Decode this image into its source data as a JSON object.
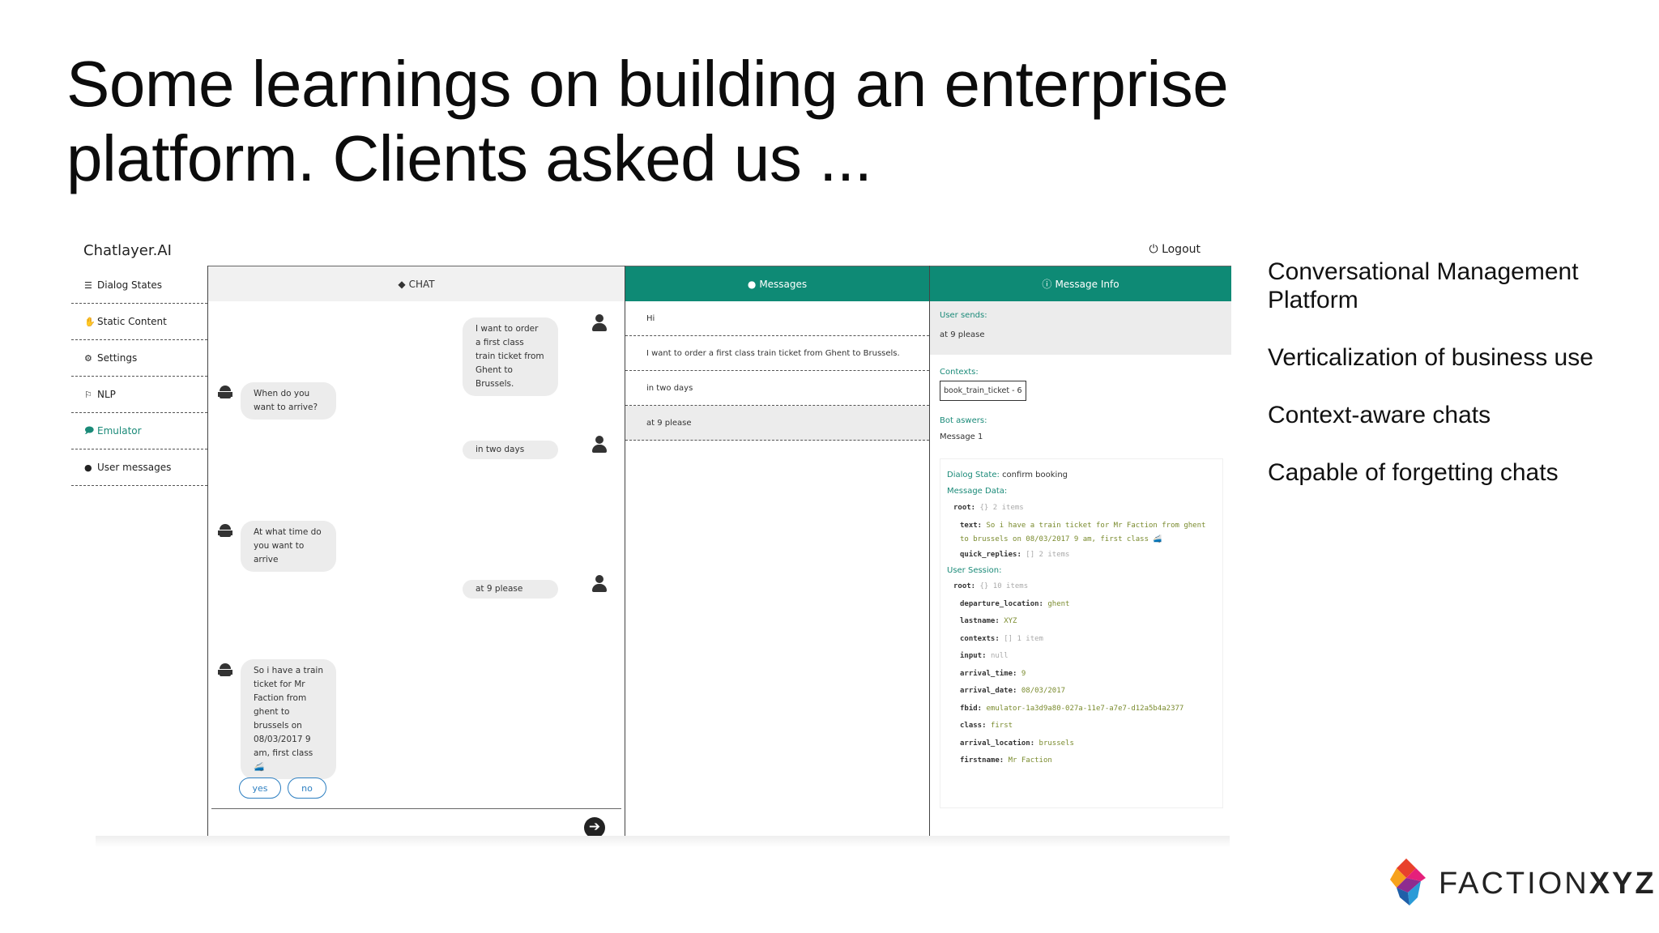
{
  "slide": {
    "title_line1": "Some learnings on building an enterprise",
    "title_line2": "platform. Clients asked us ...",
    "bullets": [
      "Conversational Management Platform",
      "Verticalization of business use",
      "Context-aware chats",
      "Capable of forgetting chats"
    ],
    "logo": {
      "light": "FACTION",
      "bold": "XYZ"
    }
  },
  "app": {
    "brand": "Chatlayer.AI",
    "logout": "Logout",
    "sidebar": [
      {
        "label": "Dialog States",
        "icon": "sitemap-icon"
      },
      {
        "label": "Static Content",
        "icon": "hand-icon"
      },
      {
        "label": "Settings",
        "icon": "gears-icon"
      },
      {
        "label": "NLP",
        "icon": "language-icon"
      },
      {
        "label": "Emulator",
        "icon": "comment-icon",
        "active": true
      },
      {
        "label": "User messages",
        "icon": "comments-icon"
      }
    ],
    "chat": {
      "header": "CHAT",
      "messages": [
        {
          "from": "user",
          "text": "I want to order a first class train ticket from Ghent to Brussels."
        },
        {
          "from": "bot",
          "text": "When do you want to arrive?"
        },
        {
          "from": "user",
          "text": "in two days"
        },
        {
          "from": "bot",
          "text": "At what time do you want to arrive"
        },
        {
          "from": "user",
          "text": "at 9 please"
        },
        {
          "from": "bot",
          "text": "So i have a train ticket for Mr Faction from ghent to brussels on 08/03/2017 9 am, first class 🚄"
        }
      ],
      "quick_replies": [
        "yes",
        "no"
      ]
    },
    "messages": {
      "header": "Messages",
      "items": [
        "Hi",
        "I want to order a first class train ticket from Ghent to Brussels.",
        "in two days",
        "at 9 please"
      ]
    },
    "info": {
      "header": "Message Info",
      "user_sends_label": "User sends:",
      "user_sends": "at 9 please",
      "contexts_label": "Contexts:",
      "context_tag": "book_train_ticket - 6",
      "bot_answers_label": "Bot aswers:",
      "bot_answer": "Message 1",
      "dialog_state_label": "Dialog State:",
      "dialog_state": "confirm booking",
      "message_data_label": "Message Data:",
      "md_root": "{} 2 items",
      "md_text": "So i have a train ticket for Mr Faction from ghent to brussels on 08/03/2017 9 am, first class 🚄",
      "md_quick": "[] 2 items",
      "user_session_label": "User Session:",
      "us_root": "{} 10 items",
      "session": [
        {
          "key": "departure_location:",
          "val": "ghent",
          "style": "s"
        },
        {
          "key": "lastname:",
          "val": "XYZ",
          "style": "s"
        },
        {
          "key": "contexts:",
          "val": "[] 1 item",
          "style": "g"
        },
        {
          "key": "input:",
          "val": "null",
          "style": "g"
        },
        {
          "key": "arrival_time:",
          "val": "9",
          "style": "s"
        },
        {
          "key": "arrival_date:",
          "val": "08/03/2017",
          "style": "s"
        },
        {
          "key": "fbid:",
          "val": "emulator-1a3d9a80-027a-11e7-a7e7-d12a5b4a2377",
          "style": "s"
        },
        {
          "key": "class:",
          "val": "first",
          "style": "s"
        },
        {
          "key": "arrival_location:",
          "val": "brussels",
          "style": "s"
        },
        {
          "key": "firstname:",
          "val": "Mr Faction",
          "style": "s"
        }
      ]
    }
  },
  "colors": {
    "accent": "#0e8a75",
    "quick_reply": "#2d7fc1"
  }
}
